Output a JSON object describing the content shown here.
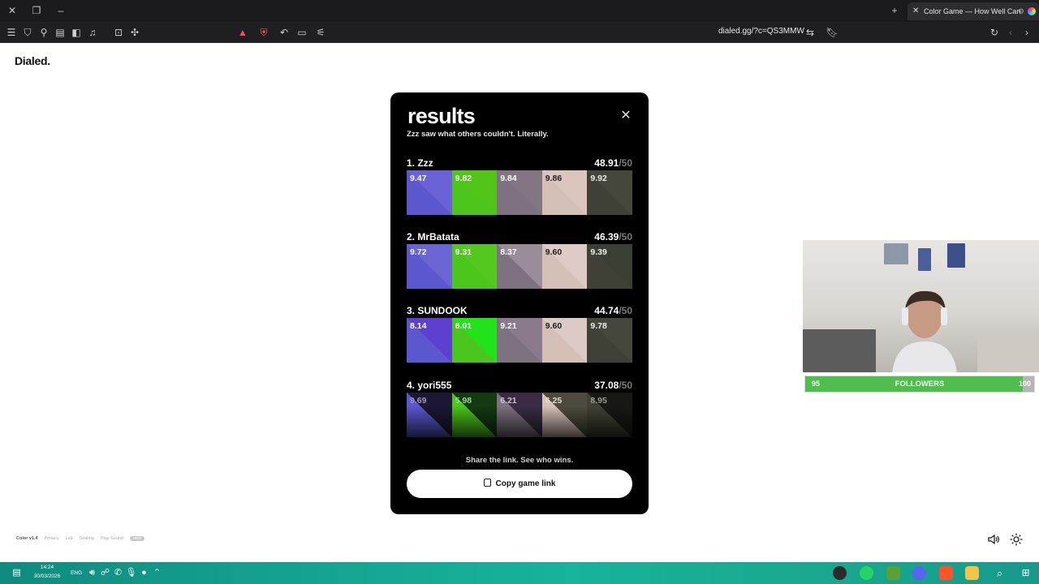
{
  "browser": {
    "tab_title": "Color Game — How Well Can",
    "url": "dialed.gg/?c=QS3MMW"
  },
  "page": {
    "brand": "Dialed."
  },
  "results": {
    "title": "results",
    "subtitle": "Zzz saw what others couldn't. Literally.",
    "max_suffix": "/50",
    "entries": [
      {
        "name": "1. Zzz",
        "score": "48.91",
        "swatches": [
          {
            "score": "9.47",
            "color": "#6a62d6",
            "target": "#5b57cf",
            "text": "#ffffff"
          },
          {
            "score": "9.82",
            "color": "#53c419",
            "target": "#4cc61d",
            "text": "#ffffff"
          },
          {
            "score": "9.84",
            "color": "#847583",
            "target": "#7e7180",
            "text": "#ffffff"
          },
          {
            "score": "9.86",
            "color": "#dac6bf",
            "target": "#d5c0b8",
            "text": "#222222"
          },
          {
            "score": "9.92",
            "color": "#45463c",
            "target": "#404136",
            "text": "#eeeeee"
          }
        ]
      },
      {
        "name": "2. MrBatata",
        "score": "46.39",
        "swatches": [
          {
            "score": "9.72",
            "color": "#6b64d4",
            "target": "#5b57cf",
            "text": "#ffffff"
          },
          {
            "score": "9.31",
            "color": "#55c820",
            "target": "#4cc61d",
            "text": "#ffffff"
          },
          {
            "score": "8.37",
            "color": "#9b8c9a",
            "target": "#7e7180",
            "text": "#ffffff"
          },
          {
            "score": "9.60",
            "color": "#dfcbc5",
            "target": "#d5c0b8",
            "text": "#222222"
          },
          {
            "score": "9.39",
            "color": "#3b3e33",
            "target": "#404136",
            "text": "#eeeeee"
          }
        ]
      },
      {
        "name": "3. SUNDOOK",
        "score": "44.74",
        "swatches": [
          {
            "score": "8.14",
            "color": "#5f3fd0",
            "target": "#5b57cf",
            "text": "#ffffff"
          },
          {
            "score": "8.01",
            "color": "#22e21a",
            "target": "#4cc61d",
            "text": "#ffffff"
          },
          {
            "score": "9.21",
            "color": "#8a7a8b",
            "target": "#7e7180",
            "text": "#ffffff"
          },
          {
            "score": "9.60",
            "color": "#dccbc5",
            "target": "#d5c0b8",
            "text": "#222222"
          },
          {
            "score": "9.78",
            "color": "#46473c",
            "target": "#404136",
            "text": "#eeeeee"
          }
        ]
      },
      {
        "name": "4. yori555",
        "score": "37.08",
        "swatches": [
          {
            "score": "9.69",
            "color": "#1c1734",
            "target": "#5b57cf",
            "text": "#9a95c6"
          },
          {
            "score": "5.98",
            "color": "#143a12",
            "target": "#4cc61d",
            "text": "#9fd391"
          },
          {
            "score": "6.21",
            "color": "#3a2c44",
            "target": "#7e7180",
            "text": "#cfc2d2"
          },
          {
            "score": "6.25",
            "color": "#4e4b3c",
            "target": "#d5c0b8",
            "text": "#e3dccf"
          },
          {
            "score": "8.95",
            "color": "#181816",
            "target": "#404136",
            "text": "#9a9a90"
          }
        ]
      }
    ],
    "share_text": "Share the link. See who wins.",
    "copy_button": "Copy game link"
  },
  "overlay": {
    "followers_label": "FOLLOWERS",
    "followers_current": "95",
    "followers_goal": "100",
    "followers_progress": 0.95
  },
  "footer": {
    "links": [
      "Color v1.4",
      "Privacy",
      "Lab",
      "Scaling",
      "Play Sound",
      "new"
    ]
  },
  "taskbar": {
    "time": "14:24",
    "date": "30/03/2026",
    "language": "ENG"
  }
}
